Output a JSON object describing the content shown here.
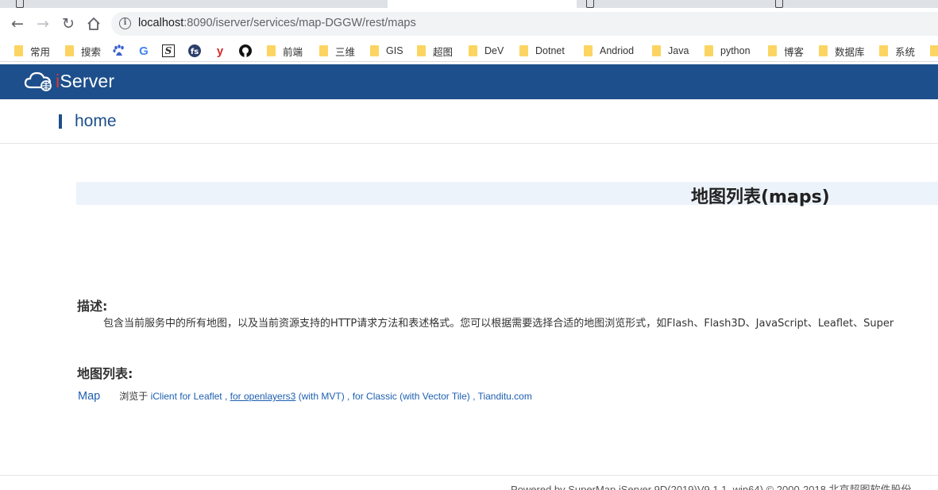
{
  "browser": {
    "address_bar": {
      "host": "localhost",
      "rest": ":8090/iserver/services/map-DGGW/rest/maps"
    },
    "bookmarks": [
      {
        "label": "常用",
        "icon": "folder-icon"
      },
      {
        "label": "搜索",
        "icon": "folder-icon"
      },
      {
        "label": "",
        "icon": "baidu-icon"
      },
      {
        "label": "",
        "icon": "google-icon"
      },
      {
        "label": "",
        "icon": "s-icon"
      },
      {
        "label": "",
        "icon": "fs-icon"
      },
      {
        "label": "",
        "icon": "y-icon"
      },
      {
        "label": "",
        "icon": "github-icon"
      },
      {
        "label": "前端",
        "icon": "folder-icon"
      },
      {
        "label": "三维",
        "icon": "folder-icon"
      },
      {
        "label": "GIS",
        "icon": "folder-icon"
      },
      {
        "label": "超图",
        "icon": "folder-icon"
      },
      {
        "label": "DeV",
        "icon": "folder-icon"
      },
      {
        "label": "Dotnet",
        "icon": "folder-icon"
      },
      {
        "label": "Andriod",
        "icon": "folder-icon"
      },
      {
        "label": "Java",
        "icon": "folder-icon"
      },
      {
        "label": "python",
        "icon": "folder-icon"
      },
      {
        "label": "博客",
        "icon": "folder-icon"
      },
      {
        "label": "数据库",
        "icon": "folder-icon"
      },
      {
        "label": "系统",
        "icon": "folder-icon"
      }
    ]
  },
  "header": {
    "logo_i": "i",
    "logo_rest": "Server"
  },
  "breadcrumb": {
    "home": "home"
  },
  "page": {
    "title": "地图列表(maps)",
    "description_heading": "描述:",
    "description": "包含当前服务中的所有地图，以及当前资源支持的HTTP请求方法和表述格式。您可以根据需要选择合适的地图浏览形式，如Flash、Flash3D、JavaScript、Leaflet、Super",
    "list_heading": "地图列表:",
    "maps": [
      {
        "name": "Map",
        "browse_prefix": "浏览于",
        "link_leaflet": "iClient for Leaflet",
        "link_ol3": "for openlayers3",
        "ol3_suffix": "(with MVT)",
        "link_classic": "for Classic",
        "classic_suffix": "(with Vector Tile)",
        "link_tianditu": "Tianditu.com"
      }
    ]
  },
  "footer": {
    "text": "Powered by SuperMap iServer 9D(2019)V9.1.1_win64) © 2000-2018 北京超图软件股份"
  }
}
